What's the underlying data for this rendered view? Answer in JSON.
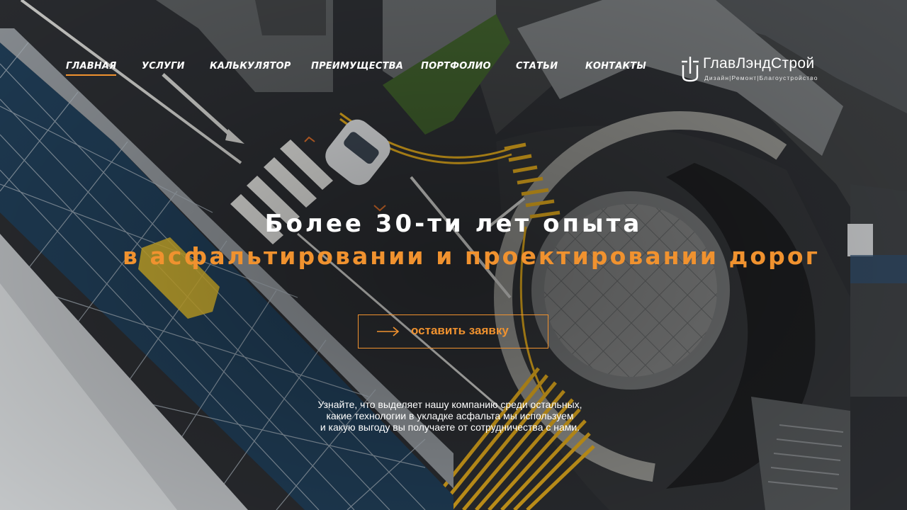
{
  "nav": {
    "items": [
      {
        "label": "ГЛАВНАЯ",
        "active": true
      },
      {
        "label": "УСЛУГИ",
        "active": false
      },
      {
        "label": "КАЛЬКУЛЯТОР",
        "active": false
      },
      {
        "label": "ПРЕИМУЩЕСТВА",
        "active": false
      },
      {
        "label": "ПОРТФОЛИО",
        "active": false
      },
      {
        "label": "СТАТЬИ",
        "active": false
      },
      {
        "label": "КОНТАКТЫ",
        "active": false
      }
    ]
  },
  "logo": {
    "name": "ГлавЛэндСтрой",
    "tagline": "Дизайн|Ремонт|Благоустройство"
  },
  "hero": {
    "title_line1": "Более 30-ти лет опыта",
    "title_line2": "в асфальтировании и проектировании дорог",
    "cta_label": "оставить заявку",
    "description": [
      "Узнайте, что выделяет нашу компанию среди остальных,",
      "какие технологии в укладке асфальта мы используем",
      "и какую выгоду вы получаете от сотрудничества с нами."
    ]
  },
  "colors": {
    "accent": "#f0922f",
    "text": "#ffffff",
    "background": "#25282c"
  },
  "icons": {
    "logo_mark": "logo-mark-icon",
    "cta_arrow": "arrow-right-icon"
  }
}
